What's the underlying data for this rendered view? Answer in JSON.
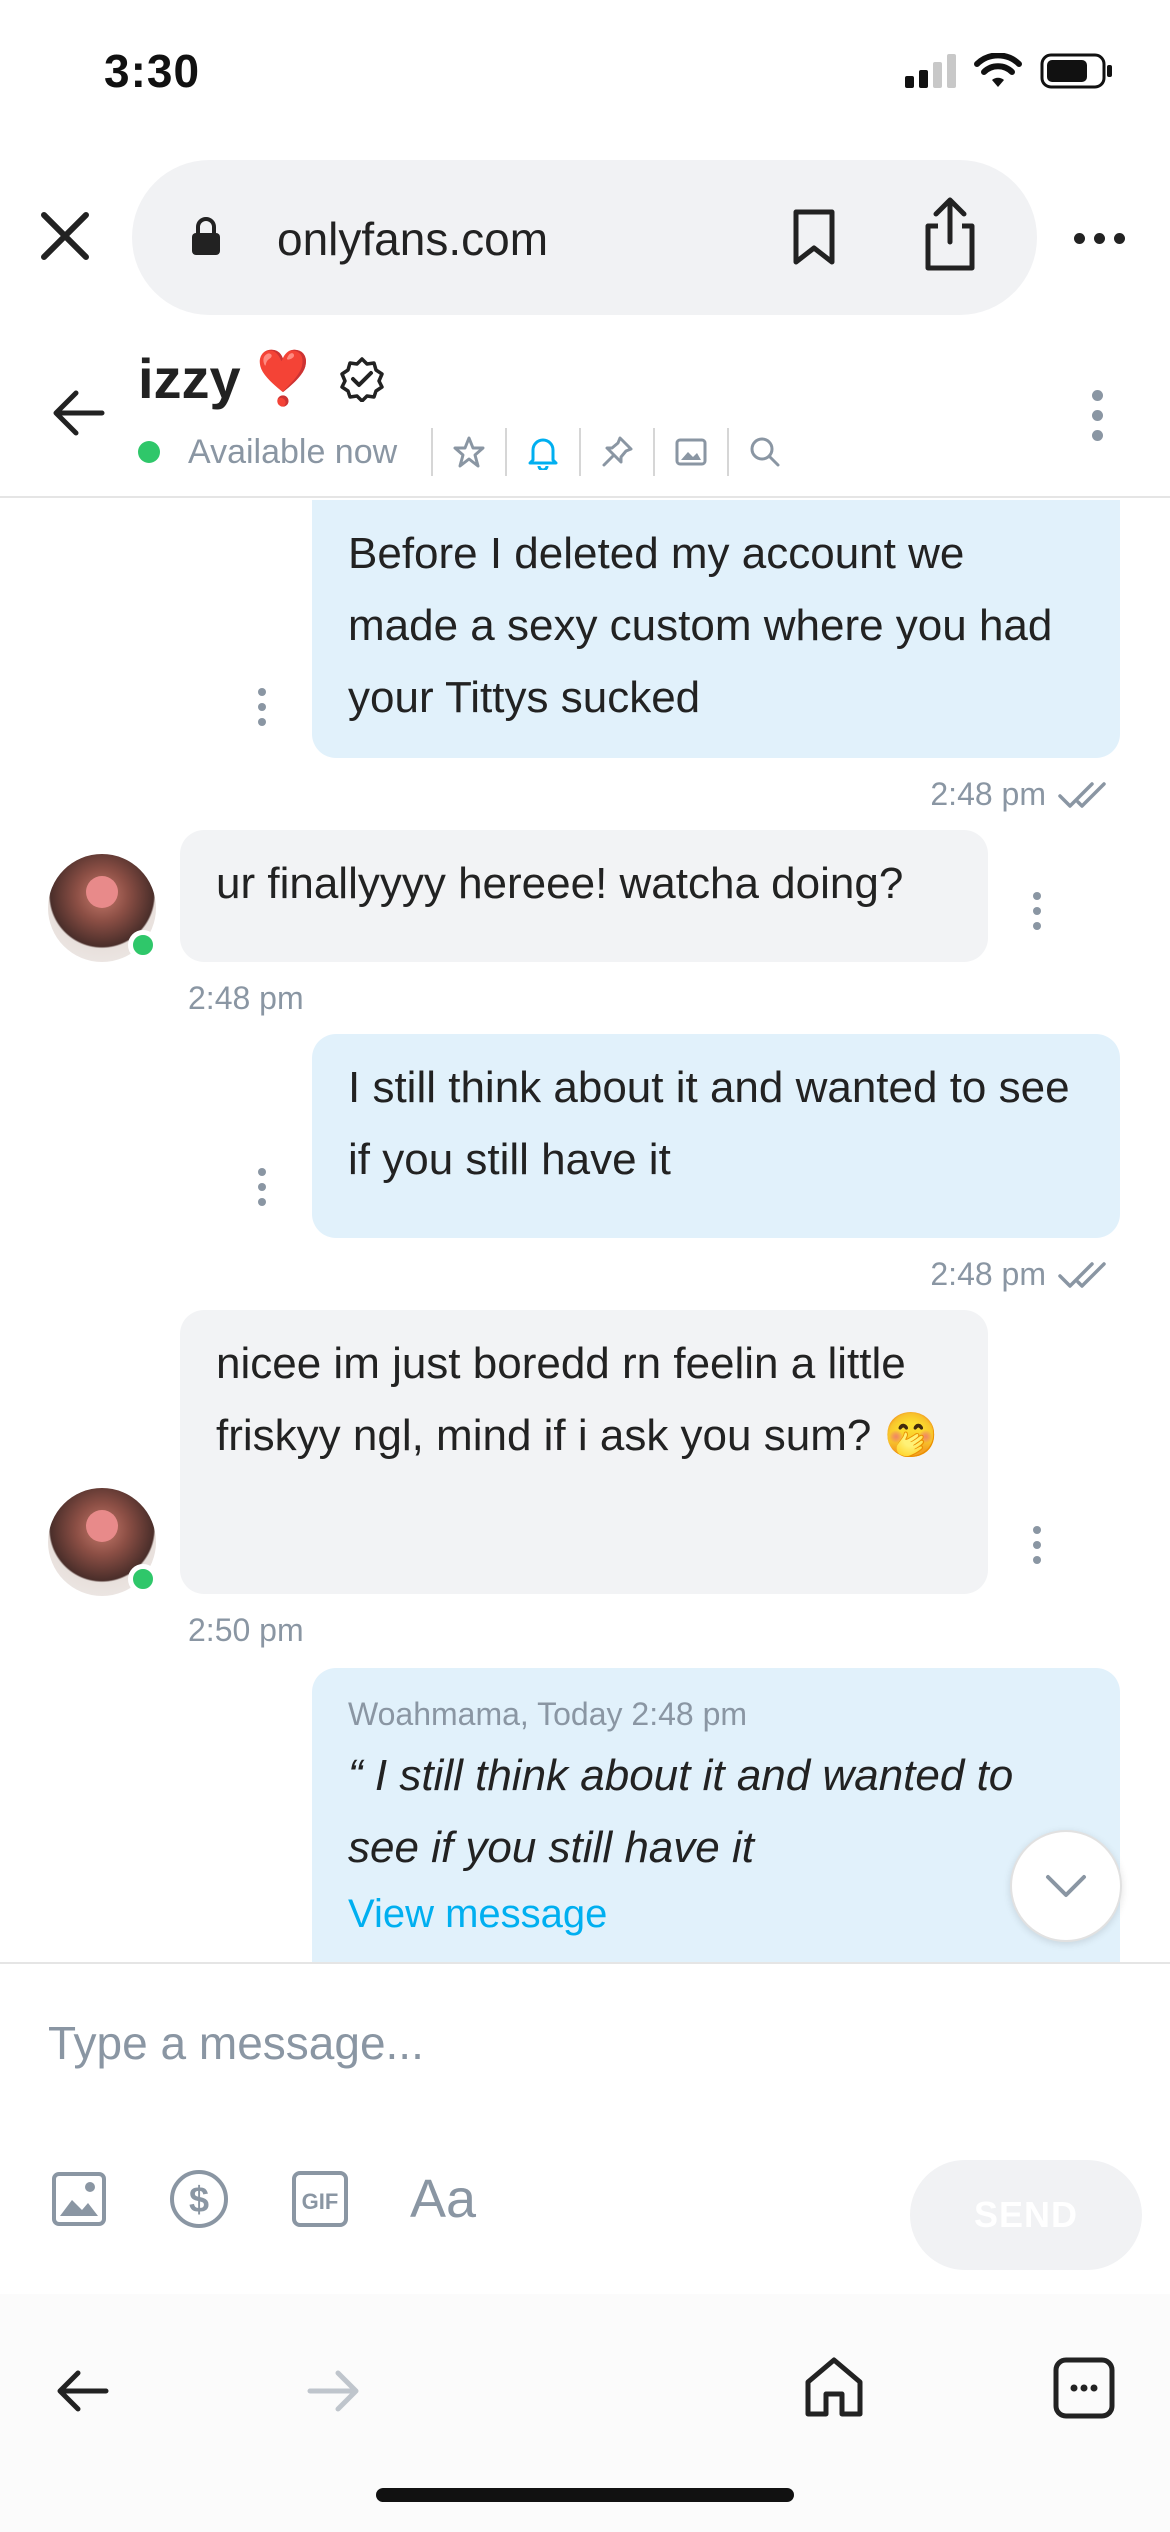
{
  "status_bar": {
    "time": "3:30"
  },
  "browser": {
    "url": "onlyfans.com"
  },
  "chat_header": {
    "name": "izzy",
    "heart": "❣️",
    "status": "Available now"
  },
  "messages": [
    {
      "direction": "out",
      "text": "Before I deleted my account we made a sexy custom where you had your Tittys sucked",
      "time": "2:48 pm"
    },
    {
      "direction": "in",
      "text": "ur finallyyyy hereee! watcha doing?",
      "time": "2:48 pm"
    },
    {
      "direction": "out",
      "text": "I still think about it and wanted to see if you still have it",
      "time": "2:48 pm"
    },
    {
      "direction": "in",
      "text": "nicee im just boredd rn feelin a little friskyy ngl, mind if i ask you sum? 🤭",
      "time": "2:50 pm"
    },
    {
      "direction": "out",
      "quote_meta": "Woahmama, Today 2:48 pm",
      "quote_text": "“ I still think about it and wanted to see if you still have it",
      "link": "View message"
    }
  ],
  "composer": {
    "placeholder": "Type a message...",
    "text_format_label": "Aa",
    "send_label": "SEND"
  },
  "colors": {
    "accent": "#00aff0",
    "online": "#2fc76a",
    "out_bubble": "#e1f1fb",
    "in_bubble": "#f2f3f5",
    "muted": "#8a96a3"
  },
  "icons": [
    "lock-icon",
    "bookmark-icon",
    "share-icon",
    "close-icon",
    "back-arrow-icon",
    "verified-icon",
    "star-icon",
    "bell-icon",
    "pin-icon",
    "image-icon",
    "search-icon",
    "more-icon",
    "gallery-icon",
    "dollar-icon",
    "gif-icon",
    "chevron-down-icon",
    "home-icon",
    "tabs-icon",
    "forward-arrow-icon"
  ]
}
